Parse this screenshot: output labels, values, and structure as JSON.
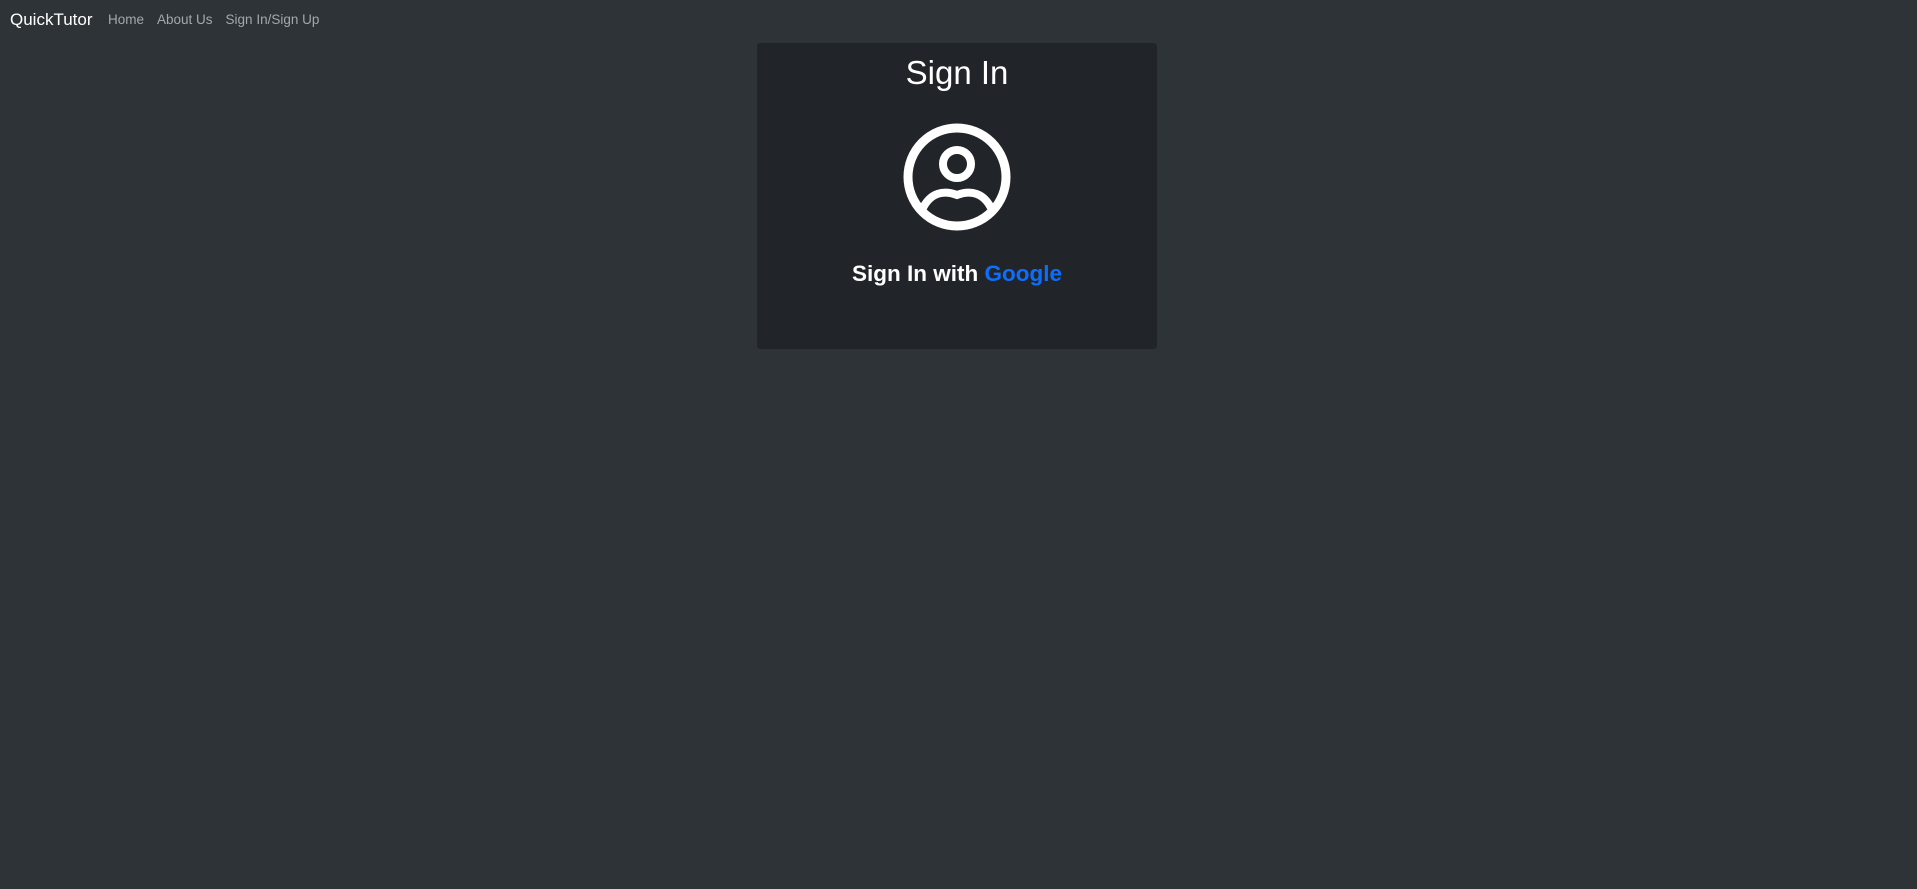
{
  "nav": {
    "brand": "QuickTutor",
    "links": [
      {
        "label": "Home"
      },
      {
        "label": "About Us"
      },
      {
        "label": "Sign In/Sign Up"
      }
    ]
  },
  "card": {
    "title": "Sign In",
    "avatar_icon": "person-circle-icon",
    "signin_prefix": "Sign In with ",
    "signin_provider": "Google"
  },
  "colors": {
    "page_background": "#2e3338",
    "card_background": "#212529",
    "nav_link": "#a3a8ad",
    "accent": "#0d6efd"
  }
}
